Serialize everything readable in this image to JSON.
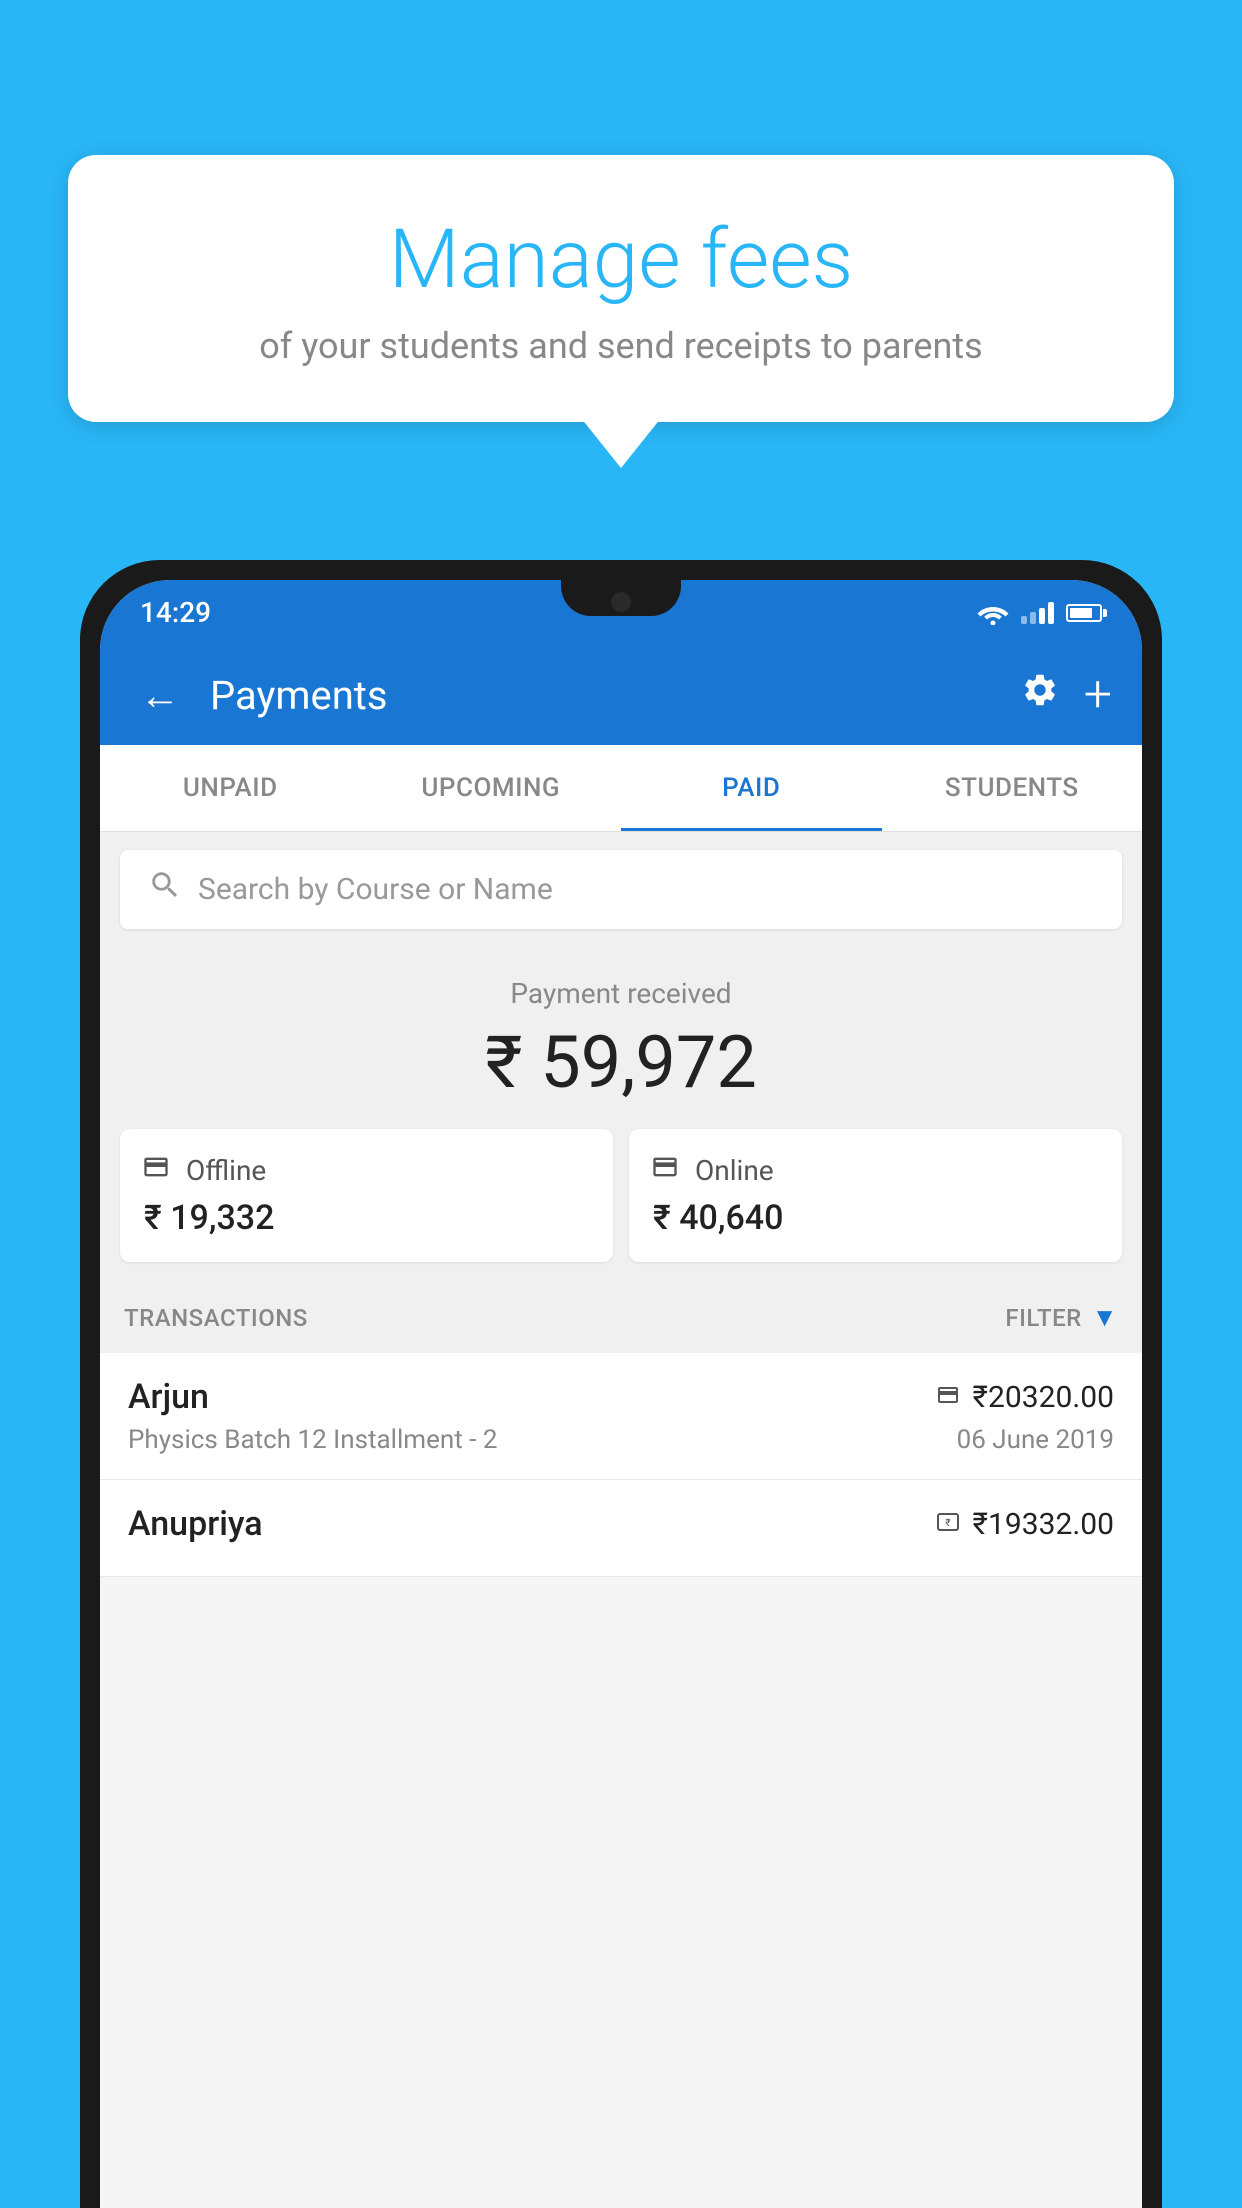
{
  "background_color": "#29b6f6",
  "bubble": {
    "title": "Manage fees",
    "subtitle": "of your students and send receipts to parents"
  },
  "status_bar": {
    "time": "14:29"
  },
  "header": {
    "title": "Payments",
    "back_label": "←",
    "settings_label": "⚙",
    "add_label": "+"
  },
  "tabs": [
    {
      "label": "UNPAID",
      "active": false
    },
    {
      "label": "UPCOMING",
      "active": false
    },
    {
      "label": "PAID",
      "active": true
    },
    {
      "label": "STUDENTS",
      "active": false
    }
  ],
  "search": {
    "placeholder": "Search by Course or Name"
  },
  "payment_summary": {
    "label": "Payment received",
    "total": "₹ 59,972",
    "offline": {
      "type": "Offline",
      "amount": "₹ 19,332"
    },
    "online": {
      "type": "Online",
      "amount": "₹ 40,640"
    }
  },
  "transactions": {
    "label": "TRANSACTIONS",
    "filter_label": "FILTER",
    "rows": [
      {
        "name": "Arjun",
        "course": "Physics Batch 12 Installment - 2",
        "amount": "₹20320.00",
        "date": "06 June 2019",
        "payment_type": "online"
      },
      {
        "name": "Anupriya",
        "course": "",
        "amount": "₹19332.00",
        "date": "",
        "payment_type": "offline"
      }
    ]
  }
}
